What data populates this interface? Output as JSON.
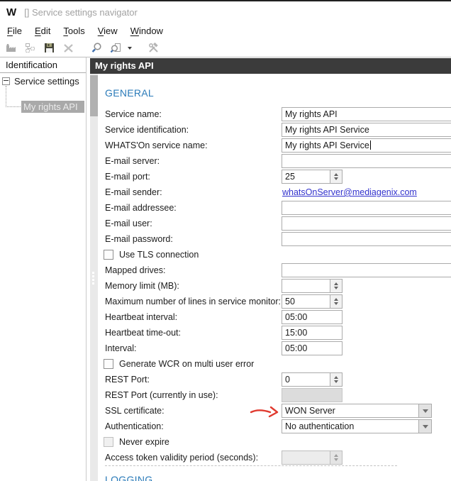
{
  "window": {
    "logo": "W",
    "title": "[] Service settings navigator"
  },
  "menubar": {
    "items": [
      "File",
      "Edit",
      "Tools",
      "View",
      "Window"
    ]
  },
  "toolbar": {
    "buttons": [
      {
        "name": "new-service-icon",
        "enabled": false
      },
      {
        "name": "hierarchy-icon",
        "enabled": false
      },
      {
        "name": "save-icon",
        "enabled": true
      },
      {
        "name": "delete-icon",
        "enabled": false
      },
      {
        "name": "search-icon",
        "enabled": true,
        "gap_before": true
      },
      {
        "name": "search-document-icon",
        "enabled": true,
        "dropdown": true
      },
      {
        "name": "customize-icon",
        "enabled": false,
        "gap_before": true
      }
    ]
  },
  "sidebar": {
    "header": "Identification",
    "tree": {
      "root": "Service settings",
      "children": [
        "My rights API"
      ],
      "selected": "My rights API"
    }
  },
  "main": {
    "header": "My rights API",
    "sections": {
      "general": "GENERAL",
      "logging": "LOGGING"
    },
    "form": {
      "rows": [
        {
          "type": "text",
          "label": "Service name:",
          "value": "My rights API"
        },
        {
          "type": "text",
          "label": "Service identification:",
          "value": "My rights API Service"
        },
        {
          "type": "text",
          "label": "WHATS'On service name:",
          "value": "My rights API Service",
          "caret": true
        },
        {
          "type": "text",
          "label": "E-mail server:",
          "value": ""
        },
        {
          "type": "spin",
          "label": "E-mail port:",
          "value": "25"
        },
        {
          "type": "link",
          "label": "E-mail sender:",
          "value": "whatsOnServer@mediagenix.com"
        },
        {
          "type": "text",
          "label": "E-mail addressee:",
          "value": ""
        },
        {
          "type": "text",
          "label": "E-mail user:",
          "value": ""
        },
        {
          "type": "text",
          "label": "E-mail password:",
          "value": ""
        },
        {
          "type": "checkbox",
          "label": "Use TLS connection",
          "checked": false
        },
        {
          "type": "text",
          "label": "Mapped drives:",
          "value": ""
        },
        {
          "type": "spin",
          "label": "Memory limit (MB):",
          "value": ""
        },
        {
          "type": "spin",
          "label": "Maximum number of lines in service monitor:",
          "value": "50"
        },
        {
          "type": "time",
          "label": "Heartbeat interval:",
          "value": "05:00"
        },
        {
          "type": "time",
          "label": "Heartbeat time-out:",
          "value": "15:00"
        },
        {
          "type": "time",
          "label": "Interval:",
          "value": "05:00"
        },
        {
          "type": "checkbox",
          "label": "Generate WCR on multi user error",
          "checked": false
        },
        {
          "type": "spin",
          "label": "REST Port:",
          "value": "0"
        },
        {
          "type": "disabled",
          "label": "REST Port (currently in use):",
          "value": ""
        },
        {
          "type": "select",
          "label": "SSL certificate:",
          "value": "WON Server",
          "annotated": true
        },
        {
          "type": "select",
          "label": "Authentication:",
          "value": "No authentication"
        },
        {
          "type": "checkbox-disabled",
          "label": "Never expire",
          "checked": false
        },
        {
          "type": "spin-disabled",
          "label": "Access token validity period (seconds):",
          "value": ""
        }
      ]
    }
  },
  "colors": {
    "panel_header_bg": "#3b3b3b",
    "section_heading": "#2b7bb9",
    "link": "#3232cd",
    "tree_selection_bg": "#a9a9a9",
    "annotation_red": "#e03a2f"
  }
}
